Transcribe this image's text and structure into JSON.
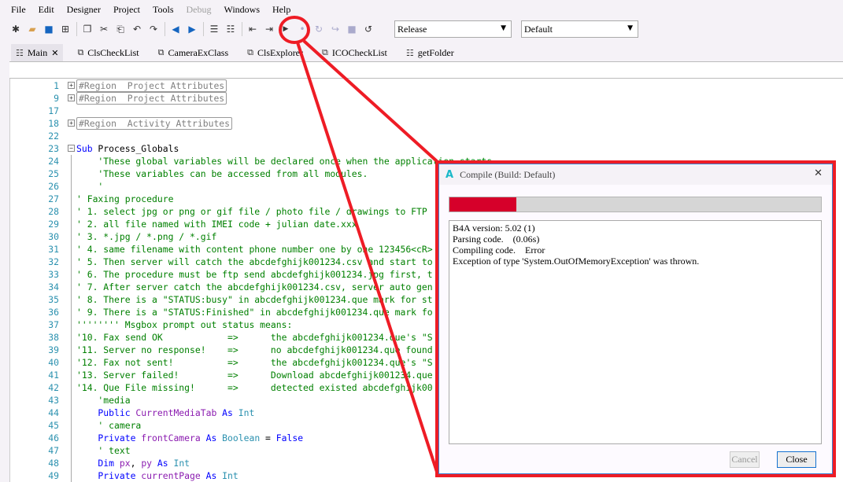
{
  "menu": [
    "File",
    "Edit",
    "Designer",
    "Project",
    "Tools",
    "Debug",
    "Windows",
    "Help"
  ],
  "toolbar": {
    "build_config": "Release",
    "build_target": "Default"
  },
  "tabs": [
    {
      "label": "Main",
      "active": true
    },
    {
      "label": "ClsCheckList"
    },
    {
      "label": "CameraExClass"
    },
    {
      "label": "ClsExplorer"
    },
    {
      "label": "ICOCheckList"
    },
    {
      "label": "getFolder"
    }
  ],
  "code": [
    {
      "n": "1",
      "fold": "+",
      "t": [
        [
          "#Region  Project Attributes",
          "region"
        ]
      ]
    },
    {
      "n": "9",
      "fold": "+",
      "t": [
        [
          "#Region  Project Attributes",
          "region"
        ]
      ]
    },
    {
      "n": "17",
      "t": []
    },
    {
      "n": "18",
      "fold": "+",
      "t": [
        [
          "#Region  Activity Attributes",
          "region"
        ]
      ]
    },
    {
      "n": "22",
      "t": []
    },
    {
      "n": "23",
      "fold": "-",
      "t": [
        [
          "Sub",
          "k"
        ],
        [
          " Process_Globals",
          "p"
        ]
      ]
    },
    {
      "n": "24",
      "t": [
        [
          "    'These global variables will be declared once when the application starts.",
          "c"
        ]
      ]
    },
    {
      "n": "25",
      "t": [
        [
          "    'These variables can be accessed from all modules.",
          "c"
        ]
      ]
    },
    {
      "n": "26",
      "t": [
        [
          "    '",
          "c"
        ]
      ]
    },
    {
      "n": "27",
      "t": [
        [
          "' Faxing procedure",
          "c"
        ]
      ]
    },
    {
      "n": "28",
      "t": [
        [
          "' 1. select jpg or png or gif file / photo file / drawings to FTP",
          "c"
        ]
      ]
    },
    {
      "n": "29",
      "t": [
        [
          "' 2. all file named with IMEI code + julian date.xxx",
          "c"
        ]
      ]
    },
    {
      "n": "30",
      "t": [
        [
          "' 3. *.jpg / *.png / *.gif",
          "c"
        ]
      ]
    },
    {
      "n": "31",
      "t": [
        [
          "' 4. same filename with content phone number one by one 123456<cR>",
          "c"
        ]
      ]
    },
    {
      "n": "32",
      "t": [
        [
          "' 5. Then server will catch the abcdefghijk001234.csv and start to",
          "c"
        ]
      ]
    },
    {
      "n": "33",
      "t": [
        [
          "' 6. The procedure must be ftp send abcdefghijk001234.jpg first, t",
          "c"
        ]
      ]
    },
    {
      "n": "34",
      "t": [
        [
          "' 7. After server catch the abcdefghijk001234.csv, server auto gen",
          "c"
        ]
      ]
    },
    {
      "n": "35",
      "t": [
        [
          "' 8. There is a \"STATUS:busy\" in abcdefghijk001234.que mark for st",
          "c"
        ]
      ]
    },
    {
      "n": "36",
      "t": [
        [
          "' 9. There is a \"STATUS:Finished\" in abcdefghijk001234.que mark fo",
          "c"
        ]
      ]
    },
    {
      "n": "37",
      "t": [
        [
          "'''''''' Msgbox prompt out status means:",
          "c"
        ]
      ]
    },
    {
      "n": "38",
      "t": [
        [
          "'10. Fax send OK            =>      the abcdefghijk001234.que's \"S",
          "c"
        ]
      ]
    },
    {
      "n": "39",
      "t": [
        [
          "'11. Server no response!    =>      no abcdefghijk001234.que found",
          "c"
        ]
      ]
    },
    {
      "n": "40",
      "t": [
        [
          "'12. Fax not sent!          =>      the abcdefghijk001234.que's \"S",
          "c"
        ]
      ]
    },
    {
      "n": "41",
      "t": [
        [
          "'13. Server failed!         =>      Download abcdefghijk001234.que",
          "c"
        ]
      ]
    },
    {
      "n": "42",
      "t": [
        [
          "'14. Que File missing!      =>      detected existed abcdefghijk00",
          "c"
        ]
      ]
    },
    {
      "n": "43",
      "t": [
        [
          "    'media",
          "c"
        ]
      ]
    },
    {
      "n": "44",
      "t": [
        [
          "    Public",
          "k"
        ],
        [
          " CurrentMediaTab",
          "v"
        ],
        [
          " As",
          "k"
        ],
        [
          " Int",
          "t"
        ]
      ]
    },
    {
      "n": "45",
      "t": [
        [
          "    ' camera",
          "c"
        ]
      ]
    },
    {
      "n": "46",
      "t": [
        [
          "    Private",
          "k"
        ],
        [
          " frontCamera",
          "v"
        ],
        [
          " As",
          "k"
        ],
        [
          " Boolean",
          "t"
        ],
        [
          " = ",
          "p"
        ],
        [
          "False",
          "k"
        ]
      ]
    },
    {
      "n": "47",
      "t": [
        [
          "    ' text",
          "c"
        ]
      ]
    },
    {
      "n": "48",
      "t": [
        [
          "    Dim",
          "k"
        ],
        [
          " px",
          "v"
        ],
        [
          ", ",
          "p"
        ],
        [
          "py",
          "v"
        ],
        [
          " As",
          "k"
        ],
        [
          " Int",
          "t"
        ]
      ]
    },
    {
      "n": "49",
      "t": [
        [
          "    Private",
          "k"
        ],
        [
          " currentPage",
          "v"
        ],
        [
          " As",
          "k"
        ],
        [
          " Int",
          "t"
        ]
      ]
    }
  ],
  "dialog": {
    "title": "Compile (Build: Default)",
    "progress_percent": 18,
    "log": [
      "B4A version: 5.02 (1)",
      "Parsing code.    (0.06s)",
      "Compiling code.    Error",
      "Exception of type 'System.OutOfMemoryException' was thrown."
    ],
    "cancel_label": "Cancel",
    "close_label": "Close"
  },
  "colors": {
    "annotation": "#ee1c25",
    "progress": "#d6002a"
  }
}
